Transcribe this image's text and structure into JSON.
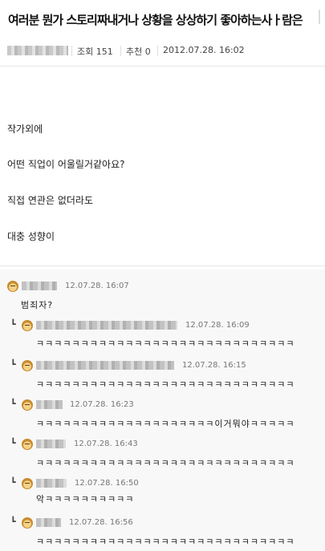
{
  "post": {
    "title": "여러분 뭔가 스토리짜내거나 상황을 상상하기 좋아하는사ㅏ람은",
    "views_label": "조회 151",
    "recommend_label": "추천 0",
    "date": "2012.07.28. 16:02",
    "body_lines": [
      "작가외에",
      "어떤 직업이 어울릴거같아요?",
      "직접 연관은 없더라도",
      "대충 성향이"
    ]
  },
  "comments": [
    {
      "time": "12.07.28. 16:07",
      "text": "범죄자?",
      "is_reply": false
    },
    {
      "time": "12.07.28. 16:09",
      "text": "ㅋㅋㅋㅋㅋㅋㅋㅋㅋㅋㅋㅋㅋㅋㅋㅋㅋㅋㅋㅋㅋㅋㅋㅋㅋㅋㅋㅋㅋ",
      "is_reply": true
    },
    {
      "time": "12.07.28. 16:15",
      "text": "ㅋㅋㅋㅋㅋㅋㅋㅋㅋㅋㅋㅋㅋㅋㅋㅋㅋㅋㅋㅋㅋㅋㅋㅋㅋㅋㅋㅋㅋ",
      "is_reply": true
    },
    {
      "time": "12.07.28. 16:23",
      "text": "ㅋㅋㅋㅋㅋㅋㅋㅋㅋㅋㅋㅋㅋㅋㅋㅋㅋㅋㅋㅋ이거뭐야ㅋㅋㅋㅋㅋ",
      "is_reply": true
    },
    {
      "time": "12.07.28. 16:43",
      "text": "ㅋㅋㅋㅋㅋㅋㅋㅋㅋㅋㅋㅋㅋㅋㅋㅋㅋㅋㅋㅋㅋㅋㅋㅋㅋㅋㅋㅋㅋ",
      "is_reply": true
    },
    {
      "time": "12.07.28. 16:50",
      "text": "악ㅋㅋㅋㅋㅋㅋㅋㅋㅋㅋ",
      "is_reply": true
    },
    {
      "time": "12.07.28. 16:56",
      "text": "ㅋㅋㅋㅋㅋㅋㅋㅋㅋㅋㅋㅋㅋㅋㅋㅋㅋㅋㅋㅋㅋㅋㅋㅋㅋㅋㅋㅋㅋ",
      "is_reply": true
    }
  ],
  "reply_marker": "┗"
}
